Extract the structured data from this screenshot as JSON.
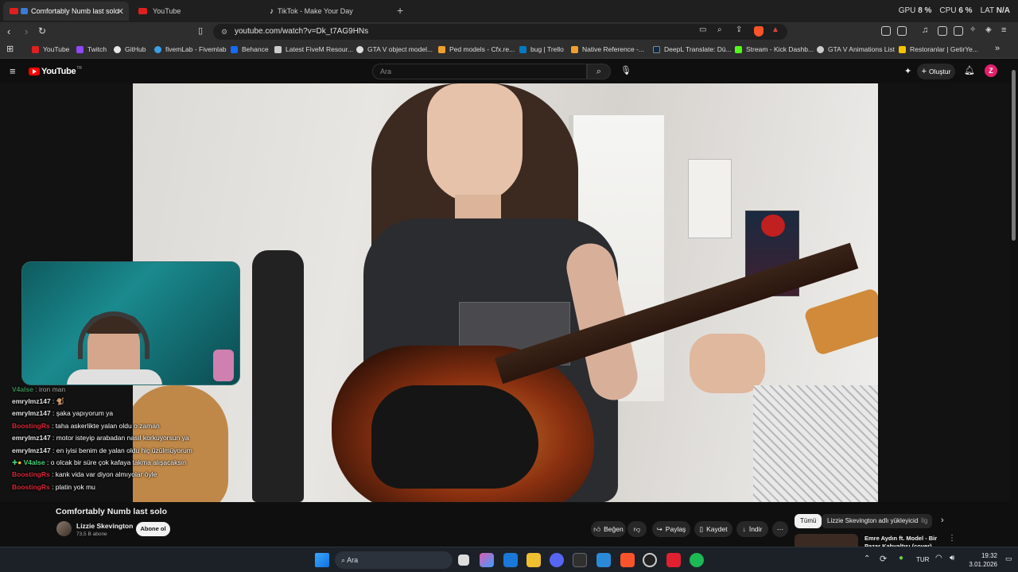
{
  "browser": {
    "tabs": [
      {
        "label": "Comfortably Numb last solo",
        "active": true
      },
      {
        "label": "YouTube",
        "active": false
      },
      {
        "label": "TikTok - Make Your Day",
        "active": false
      }
    ],
    "system_monitor": {
      "gpu_label": "GPU",
      "gpu_value": "8 %",
      "cpu_label": "CPU",
      "cpu_value": "6 %",
      "extra_label": "LAT",
      "extra_value": "N/A"
    },
    "url": "youtube.com/watch?v=Dk_t7AG9HNs",
    "bookmarks": [
      {
        "label": "YouTube",
        "color": "#e02020"
      },
      {
        "label": "Twitch",
        "color": "#9146ff"
      },
      {
        "label": "GitHub",
        "color": "#e6e6e6"
      },
      {
        "label": "fivemLab - Fivemlab",
        "color": "#3aa0e6"
      },
      {
        "label": "Behance",
        "color": "#1769ff"
      },
      {
        "label": "Latest FiveM Resour...",
        "color": "#cccccc"
      },
      {
        "label": "GTA V object model...",
        "color": "#dddddd"
      },
      {
        "label": "Ped models - Cfx.re...",
        "color": "#f0a030"
      },
      {
        "label": "bug | Trello",
        "color": "#0079bf"
      },
      {
        "label": "Native Reference -...",
        "color": "#f0a030"
      },
      {
        "label": "DeepL Translate: Dü...",
        "color": "#0f2b46"
      },
      {
        "label": "Stream - Kick Dashb...",
        "color": "#53fc18"
      },
      {
        "label": "GTA V Animations List",
        "color": "#cccccc"
      },
      {
        "label": "Restoranlar | GetirYe...",
        "color": "#5d3ebc"
      }
    ]
  },
  "youtube": {
    "logo_text": "YouTube",
    "logo_region": "TR",
    "search_placeholder": "Ara",
    "create_label": "Oluştur",
    "video_title": "Comfortably Numb last solo",
    "channel_name": "Lizzie Skevington",
    "subscribers": "73,5 B abone",
    "subscribe_label": "Abone ol",
    "actions": {
      "like": "Beğen",
      "share": "Paylaş",
      "save": "Kaydet",
      "download": "İndir"
    },
    "chips": [
      "Tümü",
      "Lizzie Skevington adlı yükleyiciden",
      "İlg"
    ],
    "recommended": {
      "title": "Emre Aydın ft. Model - Bir Pazar Kahvaltısı (cover)"
    }
  },
  "chat": {
    "messages": [
      {
        "user": "V4alse",
        "text": ": iron man",
        "color": "#4bd47a"
      },
      {
        "user": "emrylmz147",
        "text": ": 🐒",
        "color": "#e0e0e0"
      },
      {
        "user": "emrylmz147",
        "text": ": şaka yapıyorum ya",
        "color": "#e0e0e0"
      },
      {
        "user": "BoostingRs",
        "text": ": taha askerlikte yalan oldu o zaman",
        "color": "#d8283a"
      },
      {
        "user": "emrylmz147",
        "text": ": motor isteyip arabadan nasıl korkuyorsun ya",
        "color": "#e0e0e0"
      },
      {
        "user": "emrylmz147",
        "text": ": en iyisi benim de yalan oldu hiç üzülmüyorum",
        "color": "#e0e0e0"
      },
      {
        "user": "V4alse",
        "text": ": o olcak bir süre çok kafaya takma alışacaksın",
        "color": "#4bd47a"
      },
      {
        "user": "BoostingRs",
        "text": ": kank vida var diyon almıyolar öyle",
        "color": "#d8283a"
      },
      {
        "user": "BoostingRs",
        "text": ": platin yok mu",
        "color": "#d8283a"
      }
    ]
  },
  "taskbar": {
    "search_label": "Ara",
    "language": "TUR",
    "time": "19:32",
    "date": "3.01.2026"
  }
}
